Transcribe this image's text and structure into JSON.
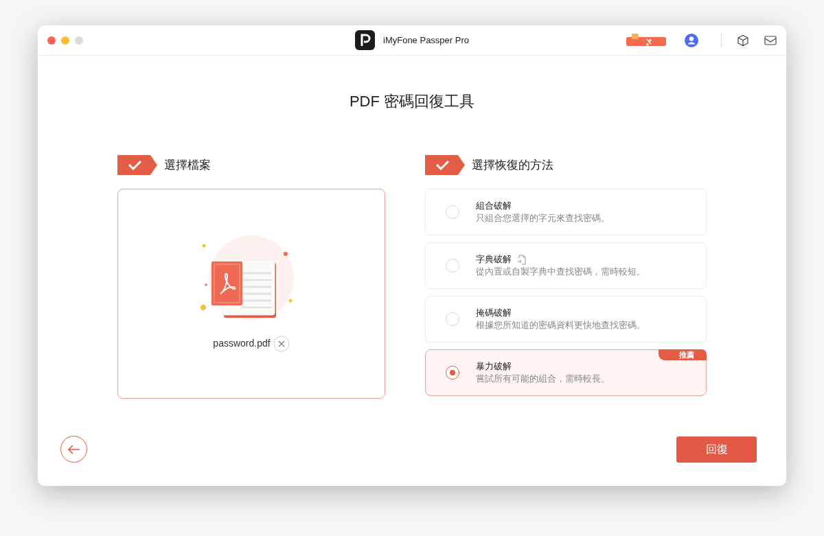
{
  "window": {
    "title": "iMyFone Passper Pro"
  },
  "page_title": "PDF 密碼回復工具",
  "steps": [
    {
      "label": "選擇檔案",
      "done": true
    },
    {
      "label": "選擇恢復的方法",
      "done": true
    }
  ],
  "file": {
    "name": "password.pdf"
  },
  "methods": [
    {
      "name": "組合破解",
      "description": "只組合您選擇的字元來查找密碼。",
      "selected": false
    },
    {
      "name": "字典破解",
      "description": "從內置或自製字典中查找密碼，需時較短。",
      "selected": false,
      "has_import": true
    },
    {
      "name": "掩碼破解",
      "description": "根據您所知道的密碼資料更快地查找密碼。",
      "selected": false
    },
    {
      "name": "暴力破解",
      "description": "嘗試所有可能的組合，需時較長。",
      "selected": true,
      "badge": "推薦"
    }
  ],
  "recover_button": "回復"
}
